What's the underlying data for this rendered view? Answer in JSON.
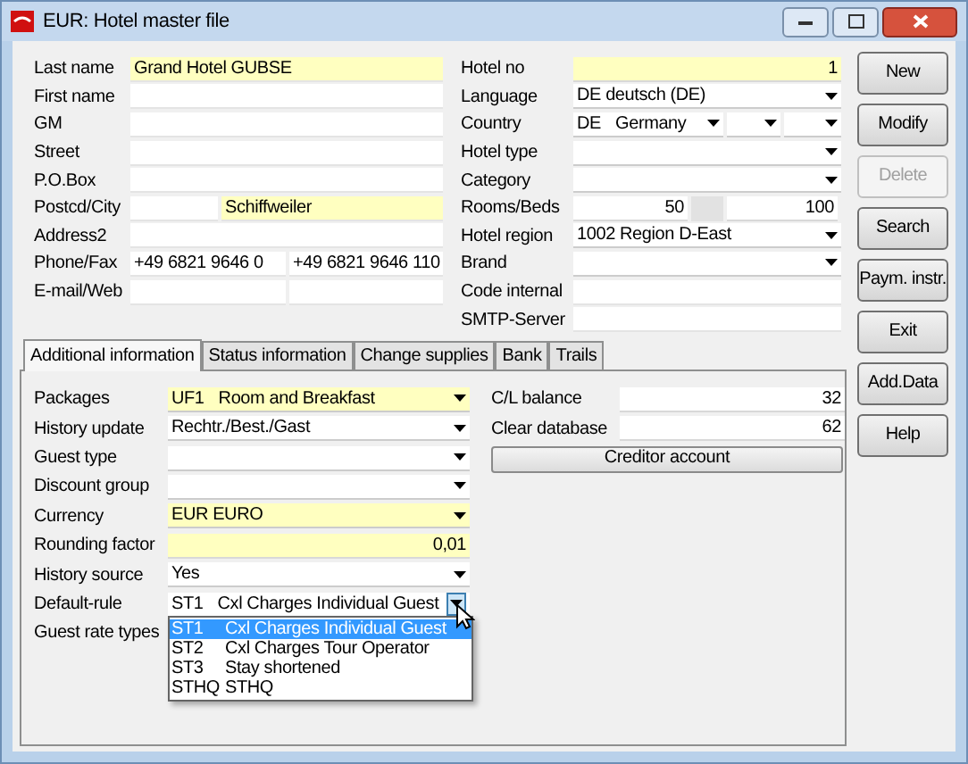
{
  "window": {
    "title": "EUR: Hotel master file"
  },
  "top_left": [
    {
      "label": "Last name",
      "kind": "single",
      "inputs": [
        {
          "kind": "text",
          "value": "Grand Hotel GUBSE",
          "highlighted": true
        }
      ]
    },
    {
      "label": "First name",
      "kind": "single",
      "inputs": [
        {
          "kind": "text",
          "highlighted": false
        }
      ]
    },
    {
      "label": "GM",
      "kind": "single",
      "inputs": [
        {
          "kind": "text",
          "highlighted": false
        }
      ]
    },
    {
      "label": "Street",
      "kind": "single",
      "inputs": [
        {
          "kind": "text",
          "highlighted": false
        }
      ]
    },
    {
      "label": "P.O.Box",
      "kind": "single",
      "inputs": [
        {
          "kind": "text",
          "highlighted": false
        }
      ]
    },
    {
      "label": "Postcd/City",
      "kind": "split",
      "inputs": [
        {
          "kind": "text",
          "highlighted": false
        },
        {
          "kind": "text",
          "value": "Schiffweiler",
          "highlighted": true
        }
      ]
    },
    {
      "label": "Address2",
      "kind": "single",
      "inputs": [
        {
          "kind": "text",
          "highlighted": false
        }
      ]
    },
    {
      "label": "Phone/Fax",
      "kind": "halves",
      "inputs": [
        {
          "kind": "text",
          "value": "+49 6821 9646 0",
          "highlighted": false
        },
        {
          "kind": "text",
          "value": "+49 6821 9646 110",
          "highlighted": false
        }
      ]
    },
    {
      "label": "E-mail/Web",
      "kind": "halves",
      "inputs": [
        {
          "kind": "text",
          "highlighted": false
        },
        {
          "kind": "text",
          "highlighted": false
        }
      ]
    }
  ],
  "top_right": [
    {
      "label": "Hotel no",
      "kind": "single",
      "inputs": [
        {
          "kind": "number",
          "value": "1",
          "highlighted": true
        }
      ]
    },
    {
      "label": "Language",
      "kind": "single",
      "inputs": [
        {
          "kind": "dropdown",
          "value": "DE deutsch (DE)",
          "highlighted": false
        }
      ]
    },
    {
      "label": "Country",
      "kind": "country",
      "inputs": [
        {
          "kind": "dropdown",
          "code": "DE",
          "value": "Germany",
          "highlighted": false
        },
        {
          "kind": "dropdown",
          "highlighted": false
        },
        {
          "kind": "dropdown",
          "highlighted": false
        }
      ]
    },
    {
      "label": "Hotel type",
      "kind": "single",
      "inputs": [
        {
          "kind": "dropdown",
          "highlighted": false
        }
      ]
    },
    {
      "label": "Category",
      "kind": "single",
      "inputs": [
        {
          "kind": "dropdown",
          "highlighted": false
        }
      ]
    },
    {
      "label": "Rooms/Beds",
      "kind": "rooms",
      "inputs": [
        {
          "kind": "number",
          "value": "50",
          "highlighted": false
        },
        {
          "kind": "number",
          "value": "100",
          "highlighted": false
        }
      ]
    },
    {
      "label": "Hotel region",
      "kind": "single",
      "inputs": [
        {
          "kind": "dropdown",
          "value": "1002 Region D-East",
          "highlighted": false
        }
      ]
    },
    {
      "label": "Brand",
      "kind": "single",
      "inputs": [
        {
          "kind": "dropdown",
          "highlighted": false
        }
      ]
    },
    {
      "label": "Code internal",
      "kind": "single",
      "inputs": [
        {
          "kind": "text",
          "highlighted": false
        }
      ]
    },
    {
      "label": "SMTP-Server",
      "kind": "single",
      "inputs": [
        {
          "kind": "text",
          "highlighted": false
        }
      ]
    }
  ],
  "tabs": [
    {
      "label": "Additional information",
      "selected": true
    },
    {
      "label": "Status information",
      "selected": false
    },
    {
      "label": "Change supplies",
      "selected": false
    },
    {
      "label": "Bank",
      "selected": false
    },
    {
      "label": "Trails",
      "selected": false
    }
  ],
  "tab_left": [
    {
      "label": "Packages",
      "inputs": [
        {
          "kind": "dropdown",
          "code": "UF1",
          "value": "Room and Breakfast",
          "highlighted": true
        }
      ]
    },
    {
      "label": "History update",
      "inputs": [
        {
          "kind": "dropdown",
          "value": "Rechtr./Best./Gast",
          "highlighted": false
        }
      ]
    },
    {
      "label": "Guest type",
      "inputs": [
        {
          "kind": "dropdown",
          "highlighted": false
        }
      ]
    },
    {
      "label": "Discount group",
      "inputs": [
        {
          "kind": "dropdown",
          "highlighted": false
        }
      ]
    },
    {
      "label": "Currency",
      "inputs": [
        {
          "kind": "dropdown",
          "value": "EUR EURO",
          "highlighted": true
        }
      ]
    },
    {
      "label": "Rounding factor",
      "inputs": [
        {
          "kind": "number",
          "value": "0,01",
          "highlighted": true
        }
      ]
    },
    {
      "label": "History source",
      "inputs": [
        {
          "kind": "dropdown",
          "value": "Yes",
          "highlighted": false
        }
      ]
    },
    {
      "label": "Default-rule",
      "inputs": [
        {
          "kind": "dropdown",
          "code": "ST1",
          "value": "Cxl Charges Individual Guest",
          "highlighted": false,
          "options": [
            {
              "code": "ST1",
              "name": "Cxl Charges Individual Guest",
              "selected": true
            },
            {
              "code": "ST2",
              "name": "Cxl Charges Tour Operator",
              "selected": false
            },
            {
              "code": "ST3",
              "name": "Stay shortened",
              "selected": false
            },
            {
              "code": "STHQ",
              "name": "STHQ",
              "selected": false
            }
          ]
        }
      ]
    },
    {
      "label": "Guest rate types"
    }
  ],
  "tab_right": [
    {
      "label": "C/L balance",
      "inputs": [
        {
          "kind": "number",
          "value": "32",
          "highlighted": false
        }
      ]
    },
    {
      "label": "Clear database",
      "inputs": [
        {
          "kind": "number",
          "value": "62",
          "highlighted": false
        }
      ]
    }
  ],
  "creditor_button": "Creditor account",
  "buttons": [
    {
      "label": "New",
      "disabled": false
    },
    {
      "label": "Modify",
      "disabled": false
    },
    {
      "label": "Delete",
      "disabled": true
    },
    {
      "label": "Search",
      "disabled": false
    },
    {
      "label": "Paym. instr.",
      "disabled": false
    },
    {
      "label": "Exit",
      "disabled": false
    },
    {
      "label": "Add.Data",
      "disabled": false
    },
    {
      "label": "Help",
      "disabled": false
    }
  ]
}
